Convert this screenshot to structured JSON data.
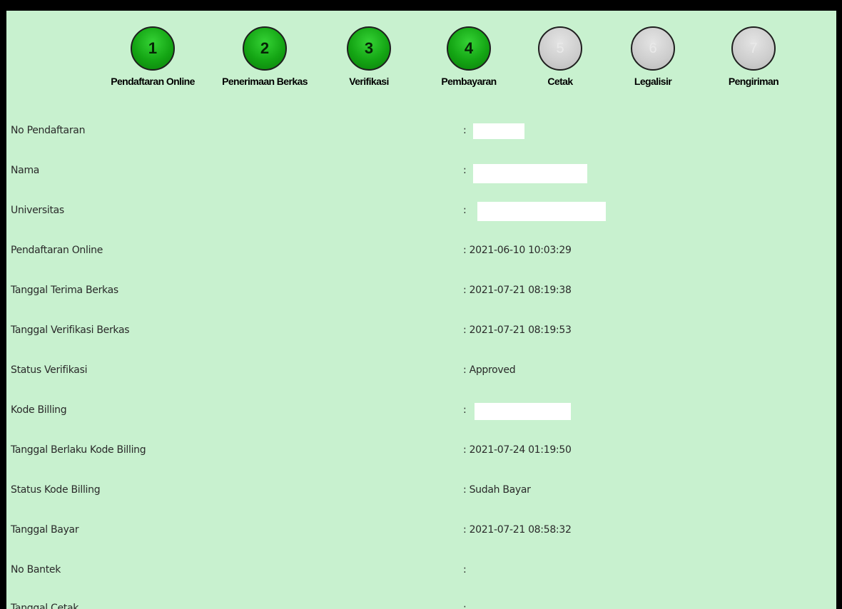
{
  "steps": [
    {
      "number": "1",
      "label": "Pendaftaran Online",
      "status": "complete"
    },
    {
      "number": "2",
      "label": "Penerimaan Berkas",
      "status": "complete"
    },
    {
      "number": "3",
      "label": "Verifikasi",
      "status": "complete"
    },
    {
      "number": "4",
      "label": "Pembayaran",
      "status": "complete"
    },
    {
      "number": "5",
      "label": "Cetak",
      "status": "pending"
    },
    {
      "number": "6",
      "label": "Legalisir",
      "status": "pending"
    },
    {
      "number": "7",
      "label": "Pengiriman",
      "status": "pending"
    }
  ],
  "details": [
    {
      "label": "No Pendaftaran",
      "value": ":"
    },
    {
      "label": "Nama",
      "value": ":"
    },
    {
      "label": "Universitas",
      "value": ":"
    },
    {
      "label": "Pendaftaran Online",
      "value": ": 2021-06-10 10:03:29"
    },
    {
      "label": "Tanggal Terima Berkas",
      "value": ": 2021-07-21 08:19:38"
    },
    {
      "label": "Tanggal Verifikasi Berkas",
      "value": ": 2021-07-21 08:19:53"
    },
    {
      "label": "Status Verifikasi",
      "value": ": Approved"
    },
    {
      "label": "Kode Billing",
      "value": ":"
    },
    {
      "label": "Tanggal Berlaku Kode Billing",
      "value": ": 2021-07-24 01:19:50"
    },
    {
      "label": "Status Kode Billing",
      "value": ": Sudah Bayar"
    },
    {
      "label": "Tanggal Bayar",
      "value": ": 2021-07-21 08:58:32"
    },
    {
      "label": "No Bantek",
      "value": ":"
    },
    {
      "label": "Tanggal Cetak",
      "value": ":"
    }
  ]
}
